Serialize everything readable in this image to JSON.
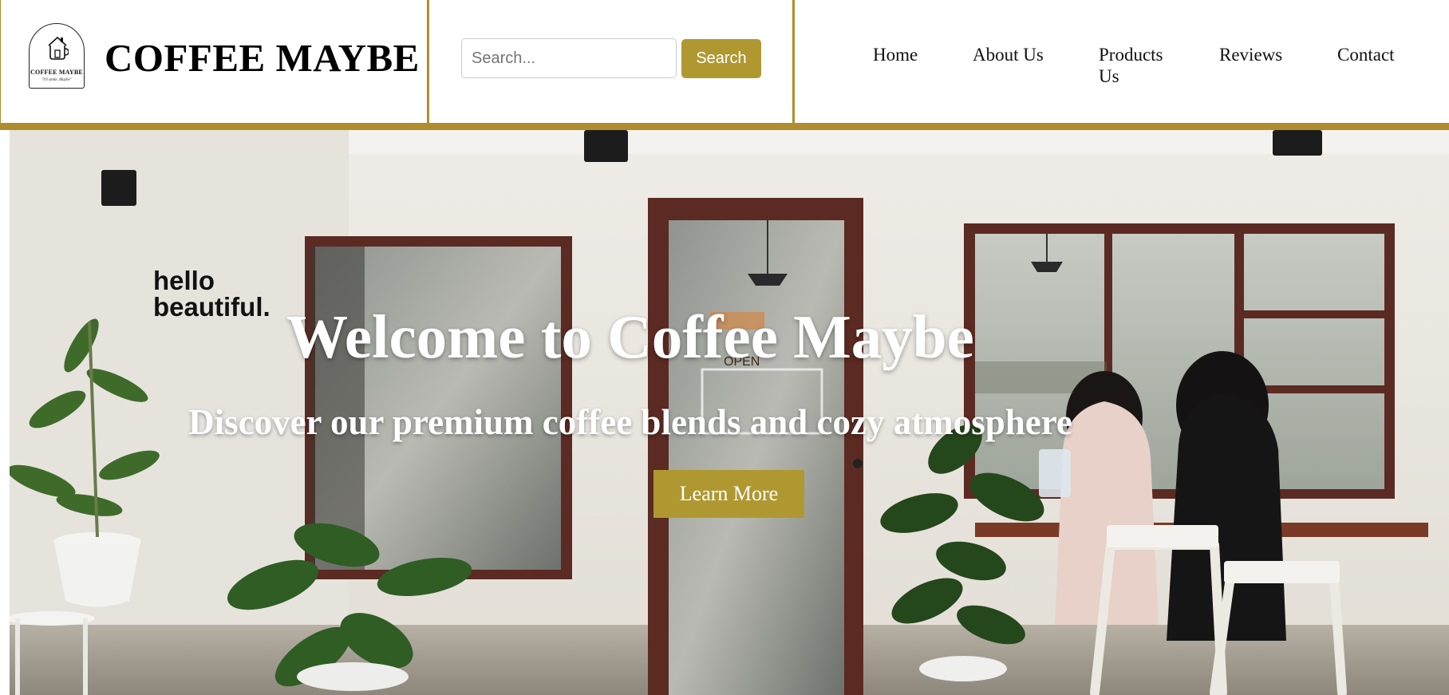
{
  "brand": {
    "name": "COFFEE MAYBE",
    "logo_name": "COFFEE MAYBE",
    "logo_tagline": "\"I'll smile, Maybe\""
  },
  "search": {
    "placeholder": "Search...",
    "value": "",
    "button_label": "Search"
  },
  "nav": {
    "items": [
      {
        "label": "Home"
      },
      {
        "label": "About Us"
      },
      {
        "label": "Products Us"
      },
      {
        "label": "Reviews"
      },
      {
        "label": "Contact"
      }
    ]
  },
  "hero": {
    "title": "Welcome to Coffee Maybe",
    "subtitle": "Discover our premium coffee blends and cozy atmosphere",
    "cta_label": "Learn More",
    "wall_text_1": "hello",
    "wall_text_2": "beautiful.",
    "sign_open": "OPEN"
  },
  "colors": {
    "accent": "#b09831",
    "border": "#b08d2c"
  },
  "icons": {
    "logo": "cup-house-icon"
  }
}
